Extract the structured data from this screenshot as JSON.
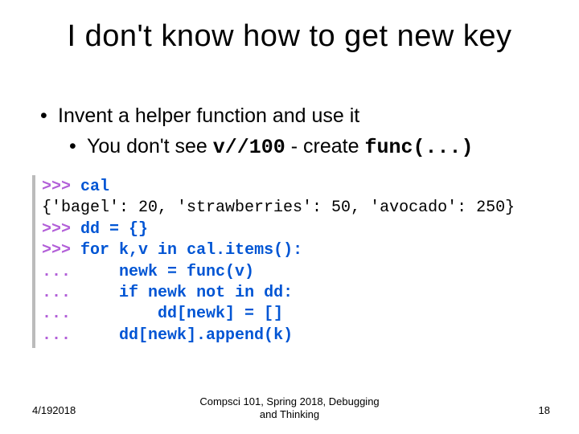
{
  "title": "I don't know how to get new key",
  "bullets": {
    "b1": "Invent a helper function and use it",
    "b2_pre": "You don't see ",
    "b2_code1": "v//100",
    "b2_mid": " - create ",
    "b2_code2": "func(...)"
  },
  "code": {
    "l1_prompt": ">>> ",
    "l1_text": "cal",
    "l2": "{'bagel': 20, 'strawberries': 50, 'avocado': 250}",
    "l3_prompt": ">>> ",
    "l3_text": "dd = {}",
    "l4_prompt": ">>> ",
    "l4_for": "for",
    "l4_vars": " k,v ",
    "l4_in": "in",
    "l4_rest": " cal.items():",
    "l5_prompt": "... ",
    "l5_indent": "    ",
    "l5_text": "newk = func(v)",
    "l6_prompt": "... ",
    "l6_indent": "    ",
    "l6_if": "if",
    "l6_mid": " newk ",
    "l6_not": "not",
    "l6_in": " in",
    "l6_rest": " dd:",
    "l7_prompt": "... ",
    "l7_indent": "        ",
    "l7_text": "dd[newk] = []",
    "l8_prompt": "... ",
    "l8_indent": "    ",
    "l8_text": "dd[newk].append(k)"
  },
  "footer": {
    "date": "4/192018",
    "mid_line1": "Compsci 101, Spring 2018, Debugging",
    "mid_line2": "and Thinking",
    "page": "18"
  }
}
